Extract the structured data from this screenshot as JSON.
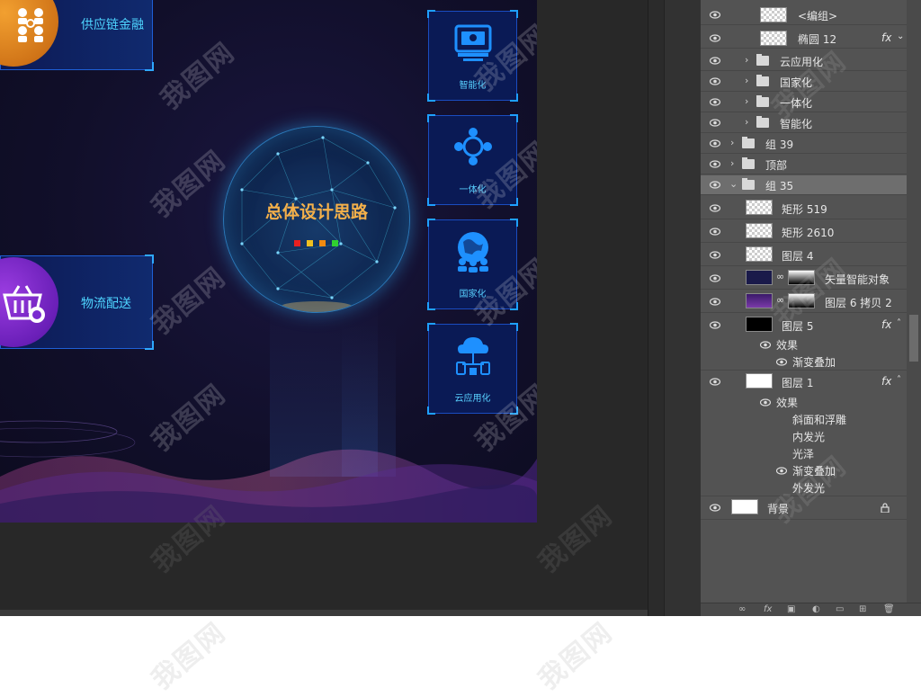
{
  "design": {
    "left_cards": [
      {
        "label": "供应链金融",
        "icon": "supply-chain-icon"
      },
      {
        "label": "物流配送",
        "icon": "logistics-basket-icon"
      }
    ],
    "modules": [
      {
        "label": "智能化",
        "icon": "monitor-icon"
      },
      {
        "label": "一体化",
        "icon": "network-icon"
      },
      {
        "label": "国家化",
        "icon": "globe-people-icon"
      },
      {
        "label": "云应用化",
        "icon": "cloud-devices-icon"
      }
    ],
    "center_title": "总体设计思路",
    "center_dots": [
      "#e82020",
      "#f0c020",
      "#f08a10",
      "#30d030"
    ]
  },
  "layers_panel": {
    "rows": [
      {
        "name": "<编组>",
        "type": "thumb-checker",
        "indent": 1,
        "fx": false
      },
      {
        "name": "椭圆 12",
        "type": "thumb-checker-shape",
        "indent": 1,
        "fx": true
      },
      {
        "name": "云应用化",
        "type": "folder",
        "indent": 1
      },
      {
        "name": "国家化",
        "type": "folder",
        "indent": 1
      },
      {
        "name": "一体化",
        "type": "folder",
        "indent": 1
      },
      {
        "name": "智能化",
        "type": "folder",
        "indent": 1
      },
      {
        "name": "组 39",
        "type": "folder",
        "indent": 0
      },
      {
        "name": "顶部",
        "type": "folder",
        "indent": 0
      },
      {
        "name": "组 35",
        "type": "folder-open",
        "indent": 0,
        "selected": true
      },
      {
        "name": "矩形 519",
        "type": "thumb-checker-shape",
        "indent": 1
      },
      {
        "name": "矩形 2610",
        "type": "thumb-checker-shape",
        "indent": 1
      },
      {
        "name": "图层 4",
        "type": "thumb-checker",
        "indent": 1
      },
      {
        "name": "矢量智能对象",
        "type": "thumb-masked",
        "indent": 1
      },
      {
        "name": "图层 6 拷贝 2",
        "type": "thumb-masked-purple",
        "indent": 1
      },
      {
        "name": "图层 5",
        "type": "thumb-black",
        "indent": 1,
        "fx": true
      },
      {
        "name": "图层 1",
        "type": "thumb-white",
        "indent": 1,
        "fx": true
      },
      {
        "name": "背景",
        "type": "thumb-white",
        "indent": 0,
        "locked": true
      }
    ],
    "effects_label": "效果",
    "layer5_effects": [
      "渐变叠加"
    ],
    "layer1_effects": [
      "斜面和浮雕",
      "内发光",
      "光泽",
      "渐变叠加",
      "外发光"
    ],
    "fx_label": "fx"
  },
  "watermark_text": "我图网",
  "colors": {
    "panel_bg": "#535353",
    "accent_title": "#f4b04a",
    "module_label": "#58d0ff"
  }
}
